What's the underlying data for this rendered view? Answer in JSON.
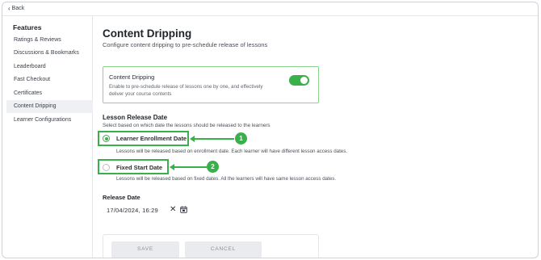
{
  "topbar": {
    "back_label": "Back"
  },
  "sidebar": {
    "title": "Features",
    "items": [
      {
        "label": "Ratings & Reviews",
        "active": false
      },
      {
        "label": "Discussions & Bookmarks",
        "active": false
      },
      {
        "label": "Leaderboard",
        "active": false
      },
      {
        "label": "Fast Checkout",
        "active": false
      },
      {
        "label": "Certificates",
        "active": false
      },
      {
        "label": "Content Dripping",
        "active": true
      },
      {
        "label": "Learner Configurations",
        "active": false
      }
    ]
  },
  "main": {
    "title": "Content Dripping",
    "subtitle": "Configure content dripping to pre-schedule release of lessons",
    "dripping_card": {
      "title": "Content Dripping",
      "description": "Enable to pre-schedule release of lessons one by one, and effectively deliver your course contents",
      "enabled": true
    },
    "release": {
      "title": "Lesson Release Date",
      "subtitle": "Select based on which date the lessons should be released to the learners",
      "options": [
        {
          "label": "Learner Enrollment Date",
          "description": "Lessons will be released based on enrollment date. Each learner will have different lesson access dates.",
          "selected": true,
          "badge": "1"
        },
        {
          "label": "Fixed Start Date",
          "description": "Lessons will be released based on fixed dates. All the learners will have same lesson access dates.",
          "selected": false,
          "badge": "2"
        }
      ]
    },
    "release_date": {
      "label": "Release Date",
      "value": "17/04/2024, 16:29"
    },
    "buttons": {
      "save": "SAVE",
      "cancel": "CANCEL"
    }
  },
  "colors": {
    "accent": "#3ab04a",
    "active_bg": "#eef0f3"
  }
}
